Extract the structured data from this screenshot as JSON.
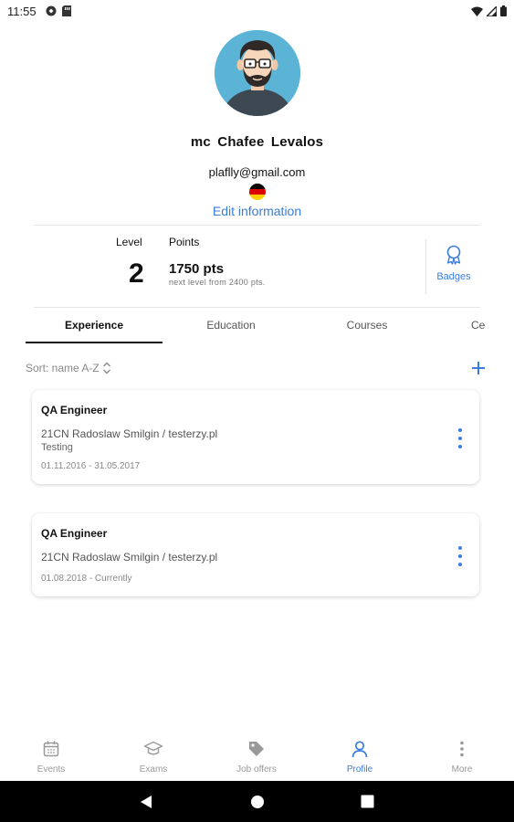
{
  "status_bar": {
    "time": "11:55"
  },
  "profile": {
    "name": "mc Chafee  Levalos",
    "email": "plaflly@gmail.com",
    "flag_colors": [
      "#000000",
      "#dd0000",
      "#ffce00"
    ],
    "edit_link": "Edit information"
  },
  "stats": {
    "level_label": "Level",
    "level_value": "2",
    "points_label": "Points",
    "points_value": "1750 pts",
    "points_next": "next level from 2400 pts.",
    "badges_label": "Badges"
  },
  "tabs": [
    {
      "label": "Experience",
      "active": true
    },
    {
      "label": "Education",
      "active": false
    },
    {
      "label": "Courses",
      "active": false
    },
    {
      "label": "Ce",
      "active": false
    }
  ],
  "sort": {
    "label": "Sort: name A-Z"
  },
  "experience": [
    {
      "title": "QA Engineer",
      "company": "21CN Radoslaw Smilgin / testerzy.pl",
      "subtitle": "Testing",
      "dates": "01.11.2016 - 31.05.2017"
    },
    {
      "title": "QA Engineer",
      "company": "21CN Radoslaw Smilgin / testerzy.pl",
      "subtitle": "",
      "dates": "01.08.2018 - Currently"
    }
  ],
  "bottom_nav": [
    {
      "label": "Events",
      "icon": "calendar-icon",
      "active": false
    },
    {
      "label": "Exams",
      "icon": "graduation-cap-icon",
      "active": false
    },
    {
      "label": "Job offers",
      "icon": "tag-icon",
      "active": false
    },
    {
      "label": "Profile",
      "icon": "person-icon",
      "active": true
    },
    {
      "label": "More",
      "icon": "more-vertical-icon",
      "active": false
    }
  ],
  "colors": {
    "accent": "#3a7de0",
    "avatar_bg": "#5bb3d5"
  }
}
